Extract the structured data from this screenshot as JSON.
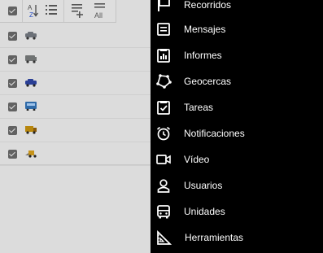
{
  "toolbar": {
    "all_label": "All",
    "az_label": "A",
    "za_label": "Z"
  },
  "vehicles": [
    {
      "type": "car-grey",
      "color": "#6c7178"
    },
    {
      "type": "van-grey",
      "color": "#6f7272"
    },
    {
      "type": "car-blue",
      "color": "#2a3f96"
    },
    {
      "type": "bus-blue",
      "color": "#2f6aa8"
    },
    {
      "type": "truck-yellow",
      "color": "#b7860d"
    },
    {
      "type": "loader-yellow",
      "color": "#c6931a"
    }
  ],
  "menu": {
    "items": [
      {
        "label": "Recorridos",
        "icon": "flag-icon"
      },
      {
        "label": "Mensajes",
        "icon": "message-icon"
      },
      {
        "label": "Informes",
        "icon": "report-icon"
      },
      {
        "label": "Geocercas",
        "icon": "geofence-icon"
      },
      {
        "label": "Tareas",
        "icon": "task-icon"
      },
      {
        "label": "Notificaciones",
        "icon": "alarm-clock-icon"
      },
      {
        "label": "Vídeo",
        "icon": "video-icon"
      },
      {
        "label": "Usuarios",
        "icon": "user-icon"
      },
      {
        "label": "Unidades",
        "icon": "bus-icon"
      },
      {
        "label": "Herramientas",
        "icon": "ruler-icon"
      }
    ]
  }
}
